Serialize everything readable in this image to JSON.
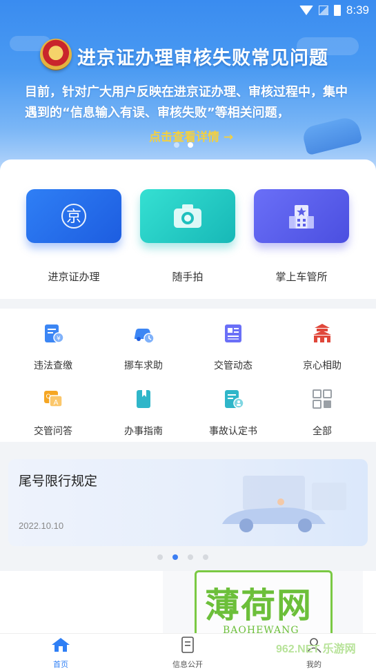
{
  "status_bar": {
    "time": "8:39"
  },
  "banner": {
    "title": "进京证办理审核失败常见问题",
    "description": "目前，针对广大用户反映在进京证办理、审核过程中，集中遇到的“信息输入有误、审核失败”等相关问题，",
    "link_label": "点击查看详情 →",
    "dots": 2,
    "active_dot": 1
  },
  "big_entries": [
    {
      "label": "进京证办理",
      "icon": "jing-icon",
      "glyph": "京"
    },
    {
      "label": "随手拍",
      "icon": "camera-icon"
    },
    {
      "label": "掌上车管所",
      "icon": "building-icon"
    }
  ],
  "grid": [
    {
      "label": "违法查缴",
      "icon": "fine-payment-icon",
      "color": "#2f7ff5"
    },
    {
      "label": "挪车求助",
      "icon": "car-move-icon",
      "color": "#2f7ff5"
    },
    {
      "label": "交管动态",
      "icon": "news-icon",
      "color": "#6a6ff7"
    },
    {
      "label": "京心相助",
      "icon": "tiananmen-icon",
      "color": "#e0473a"
    },
    {
      "label": "交管问答",
      "icon": "qa-icon",
      "color": "#f5a623"
    },
    {
      "label": "办事指南",
      "icon": "guide-book-icon",
      "color": "#2fb6c9"
    },
    {
      "label": "事故认定书",
      "icon": "accident-doc-icon",
      "color": "#2fb6c9"
    },
    {
      "label": "全部",
      "icon": "all-grid-icon",
      "color": "#9aa0a6"
    }
  ],
  "notice": {
    "title": "尾号限行规定",
    "date": "2022.10.10",
    "dots": 4,
    "active_dot": 1
  },
  "watermark": {
    "main": "薄荷网",
    "sub": "BAOHEWANG",
    "site": "962.NET 乐游网"
  },
  "bottom_nav": [
    {
      "label": "首页",
      "icon": "home-icon",
      "active": true
    },
    {
      "label": "信息公开",
      "icon": "info-doc-icon",
      "active": false
    },
    {
      "label": "我的",
      "icon": "profile-icon",
      "active": false
    }
  ],
  "colors": {
    "primary": "#2f7ff5",
    "teal": "#17b8b7",
    "purple": "#4b4fe0",
    "watermark": "#6cbf3a"
  }
}
